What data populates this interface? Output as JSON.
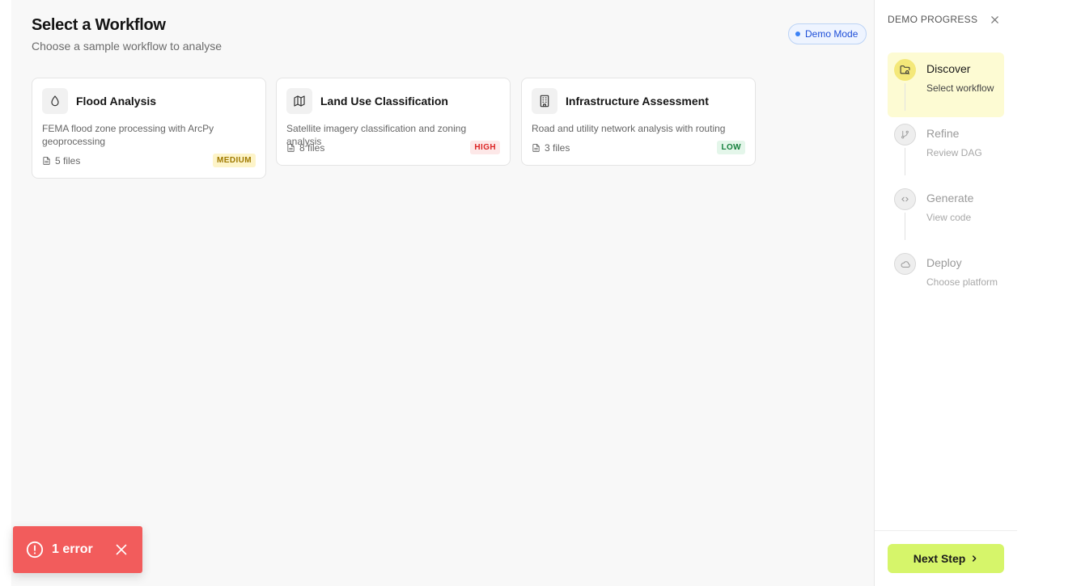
{
  "main": {
    "title": "Select a Workflow",
    "subtitle": "Choose a sample workflow to analyse",
    "demo_badge": "Demo Mode",
    "cards": [
      {
        "title": "Flood Analysis",
        "description": "FEMA flood zone processing with ArcPy geoprocessing",
        "files": "5 files",
        "complexity": "MEDIUM",
        "icon": "droplet-icon"
      },
      {
        "title": "Land Use Classification",
        "description": "Satellite imagery classification and zoning analysis",
        "files": "8 files",
        "complexity": "HIGH",
        "icon": "map-icon"
      },
      {
        "title": "Infrastructure Assessment",
        "description": "Road and utility network analysis with routing",
        "files": "3 files",
        "complexity": "LOW",
        "icon": "building-icon"
      }
    ]
  },
  "sidebar": {
    "header": "DEMO PROGRESS",
    "steps": [
      {
        "title": "Discover",
        "subtitle": "Select workflow",
        "icon": "folder-search-icon",
        "active": true
      },
      {
        "title": "Refine",
        "subtitle": "Review DAG",
        "icon": "git-branch-icon",
        "active": false
      },
      {
        "title": "Generate",
        "subtitle": "View code",
        "icon": "code-icon",
        "active": false
      },
      {
        "title": "Deploy",
        "subtitle": "Choose platform",
        "icon": "cloud-icon",
        "active": false
      }
    ],
    "next_label": "Next Step"
  },
  "toast": {
    "text": "1 error"
  },
  "colors": {
    "accent": "#d6f56a",
    "active_step_bg": "#fdfbd3",
    "error": "#f25c5c",
    "demo_badge": "#1d4ed8"
  }
}
